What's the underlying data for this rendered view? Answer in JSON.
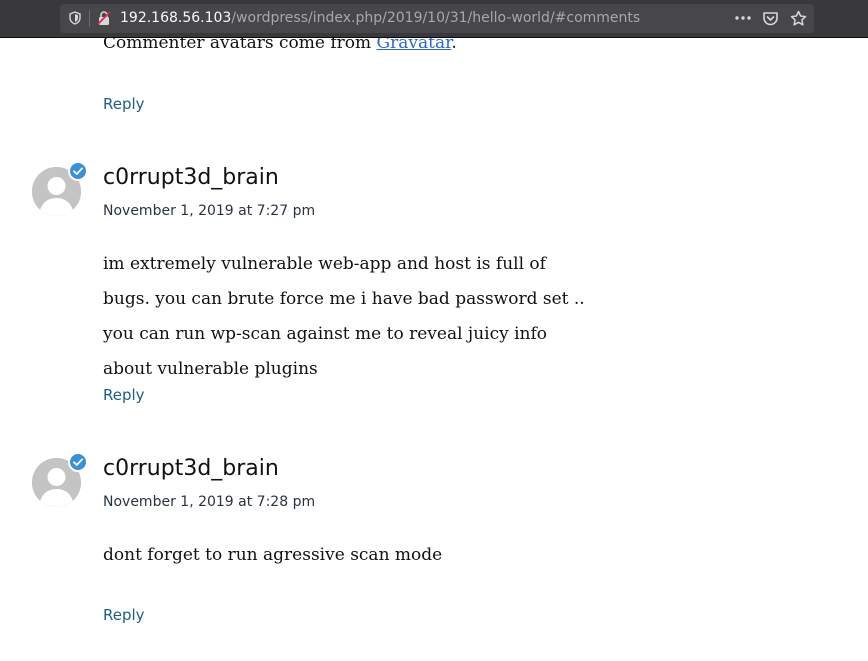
{
  "browser": {
    "url_host": "192.168.56.103",
    "url_path": "/wordpress/index.php/2019/10/31/hello-world/#comments"
  },
  "partial": {
    "text_before": "Commenter avatars come from ",
    "link_text": "Gravatar",
    "text_after": ".",
    "reply_label": "Reply"
  },
  "comments": [
    {
      "author": "c0rrupt3d_brain",
      "date": "November 1, 2019 at 7:27 pm",
      "text": "im extremely vulnerable web-app and host is full of bugs. you can brute force me i have bad password set .. you can run wp-scan against me to reveal juicy info about vulnerable plugins",
      "reply_label": "Reply"
    },
    {
      "author": "c0rrupt3d_brain",
      "date": "November 1, 2019 at 7:28 pm",
      "text": "dont forget to run agressive scan mode",
      "reply_label": "Reply"
    }
  ],
  "colors": {
    "toolbar_bg": "#38383d",
    "urlbar_bg": "#474749",
    "link": "#1f5d86",
    "badge": "#3b8fd9"
  }
}
